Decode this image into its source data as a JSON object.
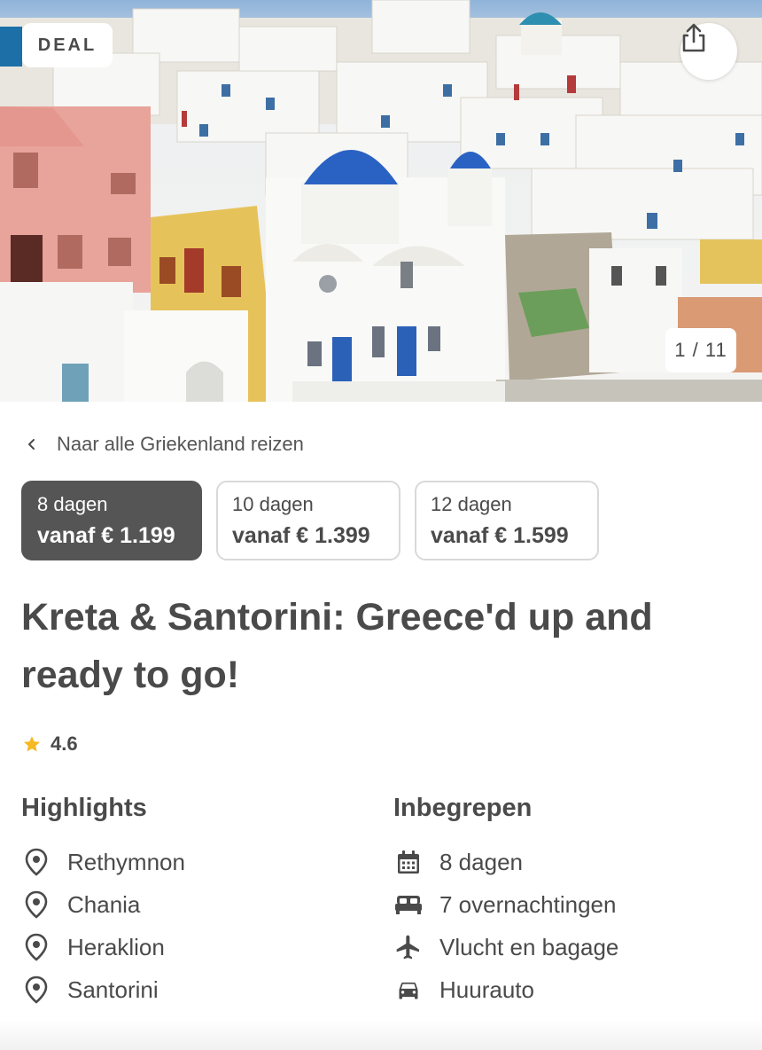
{
  "hero": {
    "badge": "DEAL",
    "counter": "1 / 11",
    "share_icon": "share-icon"
  },
  "back_link": {
    "label": "Naar alle Griekenland reizen",
    "icon": "chevron-left-icon"
  },
  "durations": [
    {
      "days": "8 dagen",
      "price": "vanaf € 1.199",
      "selected": true
    },
    {
      "days": "10 dagen",
      "price": "vanaf € 1.399",
      "selected": false
    },
    {
      "days": "12 dagen",
      "price": "vanaf € 1.599",
      "selected": false
    }
  ],
  "title": "Kreta & Santorini: Greece'd up and ready to go!",
  "rating": {
    "value": "4.6",
    "star_color": "#f5b921"
  },
  "highlights": {
    "heading": "Highlights",
    "items": [
      {
        "label": "Rethymnon",
        "icon": "location-pin-icon"
      },
      {
        "label": "Chania",
        "icon": "location-pin-icon"
      },
      {
        "label": "Heraklion",
        "icon": "location-pin-icon"
      },
      {
        "label": "Santorini",
        "icon": "location-pin-icon"
      }
    ]
  },
  "included": {
    "heading": "Inbegrepen",
    "items": [
      {
        "label": "8 dagen",
        "icon": "calendar-icon"
      },
      {
        "label": "7 overnachtingen",
        "icon": "bed-icon"
      },
      {
        "label": "Vlucht en bagage",
        "icon": "airplane-icon"
      },
      {
        "label": "Huurauto",
        "icon": "car-icon"
      }
    ]
  },
  "colors": {
    "text": "#4a4a4a",
    "active_pill": "#555555",
    "dome_blue": "#2a62c4"
  }
}
